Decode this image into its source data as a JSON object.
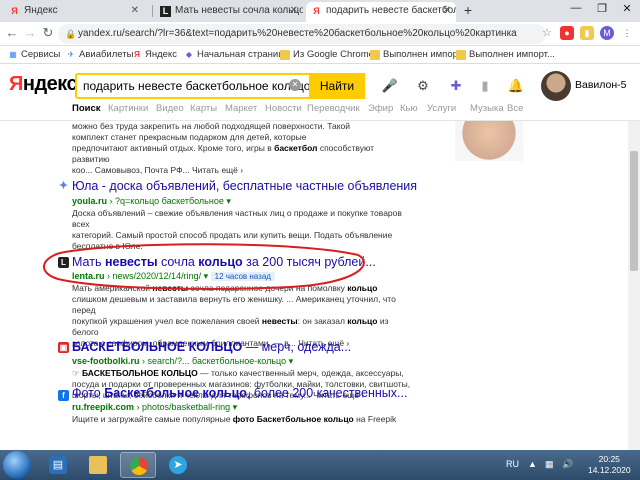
{
  "browser": {
    "tabs": [
      {
        "label": "Яндекс",
        "icon": "yandex-favicon",
        "active": false
      },
      {
        "label": "Мать невесты сочла кольцо за",
        "icon": "lenta-favicon",
        "active": false
      },
      {
        "label": "подарить невесте баскетбольно",
        "icon": "yandex-favicon",
        "active": true
      }
    ],
    "address": "yandex.ru/search/?lr=36&text=подарить%20невесте%20баскетбольное%20кольцо%20картинка",
    "bookmarks": [
      {
        "label": "Сервисы",
        "icon": "apps-icon"
      },
      {
        "label": "Авиабилеты",
        "icon": "plane-icon"
      },
      {
        "label": "Яндекс",
        "icon": "yandex-icon"
      },
      {
        "label": "Начальная страница",
        "icon": "page-icon"
      },
      {
        "label": "Из Google Chrome",
        "icon": "folder-icon"
      },
      {
        "label": "Выполнен импорт",
        "icon": "folder-icon"
      },
      {
        "label": "Выполнен импорт...",
        "icon": "folder-icon"
      }
    ]
  },
  "yandex": {
    "logo_red": "Я",
    "logo_rest": "ндекс",
    "query": "подарить невесте баскетбольное кольцо",
    "search_button": "Найти",
    "user": "Вавилон-5",
    "services": [
      "Поиск",
      "Картинки",
      "Видео",
      "Карты",
      "Маркет",
      "Новости",
      "Переводчик",
      "Эфир",
      "Кью",
      "Услуги",
      "Музыка",
      "Все"
    ]
  },
  "results": {
    "r0": {
      "snippet_l1": "можно без труда закрепить на любой подходящей поверхности. Такой",
      "snippet_l2": "комплект станет прекрасным подарком для детей, которые",
      "snippet_l3a": "предпочитают активный отдых. Кроме того, игры в ",
      "snippet_l3b": "баскетбол",
      "snippet_l3c": " способствуют развитию",
      "snippet_l4": "коо... Самовывоз, Почта РФ...",
      "more": "Читать ещё ›"
    },
    "r1": {
      "title": "Юла - доска объявлений, бесплатные частные объявления",
      "url_domain": "youla.ru",
      "url_path": " › ?q=кольцо баскетбольное ▾",
      "snippet_l1": "Доска объявлений – свежие объявления частных лиц о продаже и покупке товаров всех",
      "snippet_l2": "категорий. Самый простой способ продать или купить вещи. Подать объявление",
      "snippet_l3": "бесплатно в Юле."
    },
    "r2": {
      "title_a": "Мать ",
      "title_b": "невесты",
      "title_c": " сочла ",
      "title_d": "кольцо",
      "title_e": " за 200 тысяч рублей...",
      "url_domain": "lenta.ru",
      "url_path": " › news/2020/12/14/ring/ ▾",
      "badge": "12 часов назад",
      "snippet_l1a": "Мать американской ",
      "snippet_l1b": "невесты",
      "snippet_l1c": " сочла подаренное дочери на помолвку ",
      "snippet_l1d": "кольцо",
      "snippet_l2": "слишком дешевым и заставила вернуть его женишку. ... Американец уточнил, что перед",
      "snippet_l3a": "покупкой украшения учел все пожелания своей ",
      "snippet_l3b": "невесты",
      "snippet_l3c": ": он заказал ",
      "snippet_l3d": "кольцо",
      "snippet_l3e": " из белого",
      "snippet_l4": "золота с сапфиром, обрамленным бриллиантами, — в...",
      "more": "Читать ещё ›"
    },
    "r3": {
      "title_a": "БАСКЕТБОЛЬНОЕ КОЛЬЦО",
      "title_b": " — мерч, одежда...",
      "url_domain": "vse-footbolki.ru",
      "url_path": " › search/?... баскетбольное-кольцо ▾",
      "snippet_l1a": "☞ ",
      "snippet_l1b": "БАСКЕТБОЛЬНОЕ КОЛЬЦО",
      "snippet_l1c": " — только качественный мерч, одежда, аксессуары,",
      "snippet_l2": "посуда и подарки от проверенных магазинов: футболки, майки, толстовки, свитшоты,",
      "snippet_l3": "шорты, штаны, бейсболки и чехлы для телефонов на тему...",
      "more": "Читать ещё ›"
    },
    "r4": {
      "title_a": "Фото ",
      "title_b": "Баскетбольное кольцо",
      "title_c": ", более 200 качественных...",
      "url_domain": "ru.freepik.com",
      "url_path": " › photos/basketball-ring ▾",
      "snippet_l1a": "Ищите и загружайте самые популярные ",
      "snippet_l1b": "фото Баскетбольное кольцо",
      "snippet_l1c": " на Freepik"
    }
  },
  "taskbar": {
    "lang": "RU",
    "time": "20:25",
    "date": "14.12.2020"
  }
}
